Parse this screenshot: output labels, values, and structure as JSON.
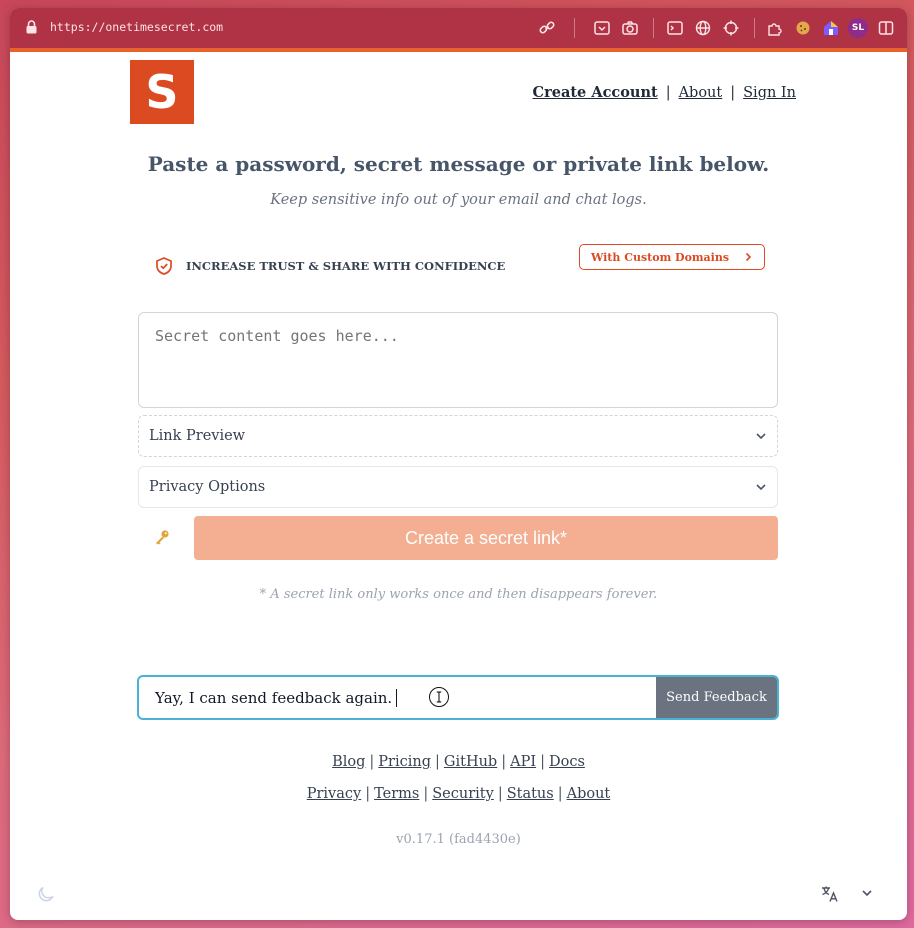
{
  "browser": {
    "url": "https://onetimesecret.com",
    "profile_initials": "SL",
    "toolbar_icons": [
      "link-icon",
      "reader-icon",
      "camera-icon",
      "terminal-icon",
      "globe-icon",
      "crosshair-icon",
      "extension-puzzle-icon",
      "cookie-icon",
      "home-shield-icon",
      "sidebar-icon"
    ]
  },
  "header": {
    "logo_letter": "S",
    "nav": {
      "create_account": "Create Account",
      "about": "About",
      "sign_in": "Sign In",
      "separator": "|"
    }
  },
  "hero": {
    "headline": "Paste a password, secret message or private link below.",
    "subline": "Keep sensitive info out of your email and chat logs."
  },
  "promo": {
    "text": "INCREASE TRUST & SHARE WITH CONFIDENCE",
    "button_label": "With Custom Domains"
  },
  "form": {
    "secret_placeholder": "Secret content goes here...",
    "link_preview_label": "Link Preview",
    "privacy_options_label": "Privacy Options",
    "create_button_label": "Create a secret link*",
    "disclaimer": "* A secret link only works once and then disappears forever."
  },
  "feedback": {
    "value": "Yay, I can send feedback again.",
    "button_label": "Send Feedback"
  },
  "footer": {
    "row1": [
      "Blog",
      "Pricing",
      "GitHub",
      "API",
      "Docs"
    ],
    "row2": [
      "Privacy",
      "Terms",
      "Security",
      "Status",
      "About"
    ],
    "separator": "|",
    "version": "v0.17.1 (fad4430e)"
  },
  "colors": {
    "brand": "#dc4a22",
    "create_button": "#f4ae92",
    "feedback_border": "#4bb2d6",
    "send_button": "#6b7280",
    "toolbar": "#b03345"
  }
}
